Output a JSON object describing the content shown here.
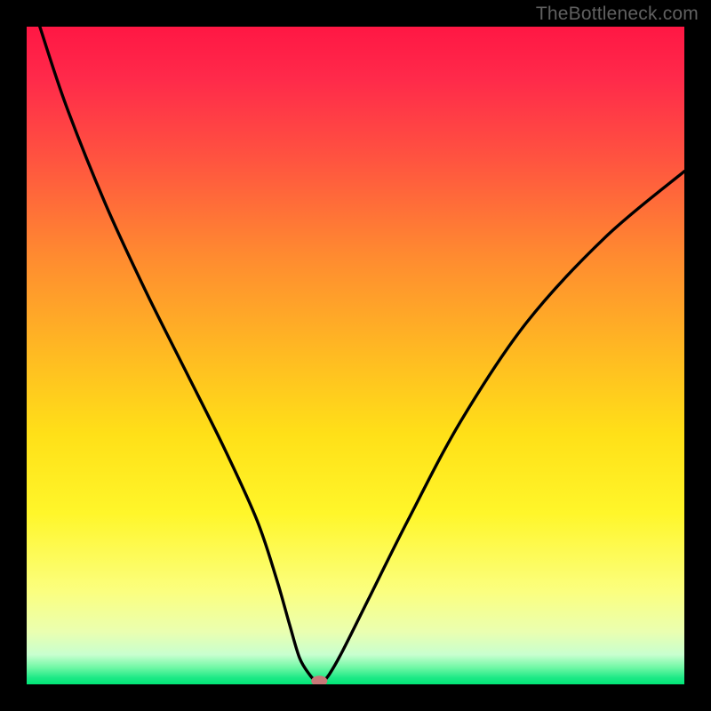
{
  "watermark": "TheBottleneck.com",
  "chart_data": {
    "type": "line",
    "title": "",
    "xlabel": "",
    "ylabel": "",
    "xlim": [
      0,
      100
    ],
    "ylim": [
      0,
      100
    ],
    "grid": false,
    "series": [
      {
        "name": "bottleneck-curve",
        "x": [
          2,
          6,
          12,
          18,
          24,
          30,
          35,
          38,
          40,
          41.5,
          43,
          44,
          45,
          46,
          48,
          52,
          58,
          66,
          76,
          88,
          100
        ],
        "values": [
          100,
          88,
          73,
          60,
          48,
          36,
          25,
          16,
          9,
          4,
          1.5,
          0.5,
          0.5,
          1.5,
          5,
          13,
          25,
          40,
          55,
          68,
          78
        ]
      }
    ],
    "marker": {
      "x": 44.5,
      "y": 0.5,
      "color": "#c87878"
    },
    "background_gradient": {
      "stops": [
        {
          "offset": 0.0,
          "color": "#ff1744"
        },
        {
          "offset": 0.08,
          "color": "#ff2a4a"
        },
        {
          "offset": 0.2,
          "color": "#ff5340"
        },
        {
          "offset": 0.35,
          "color": "#ff8b30"
        },
        {
          "offset": 0.5,
          "color": "#ffbb22"
        },
        {
          "offset": 0.62,
          "color": "#ffe018"
        },
        {
          "offset": 0.74,
          "color": "#fff62a"
        },
        {
          "offset": 0.86,
          "color": "#fbff80"
        },
        {
          "offset": 0.92,
          "color": "#eaffb0"
        },
        {
          "offset": 0.955,
          "color": "#c8ffcf"
        },
        {
          "offset": 0.975,
          "color": "#6df7a4"
        },
        {
          "offset": 0.99,
          "color": "#1de986"
        },
        {
          "offset": 1.0,
          "color": "#00e676"
        }
      ]
    }
  }
}
